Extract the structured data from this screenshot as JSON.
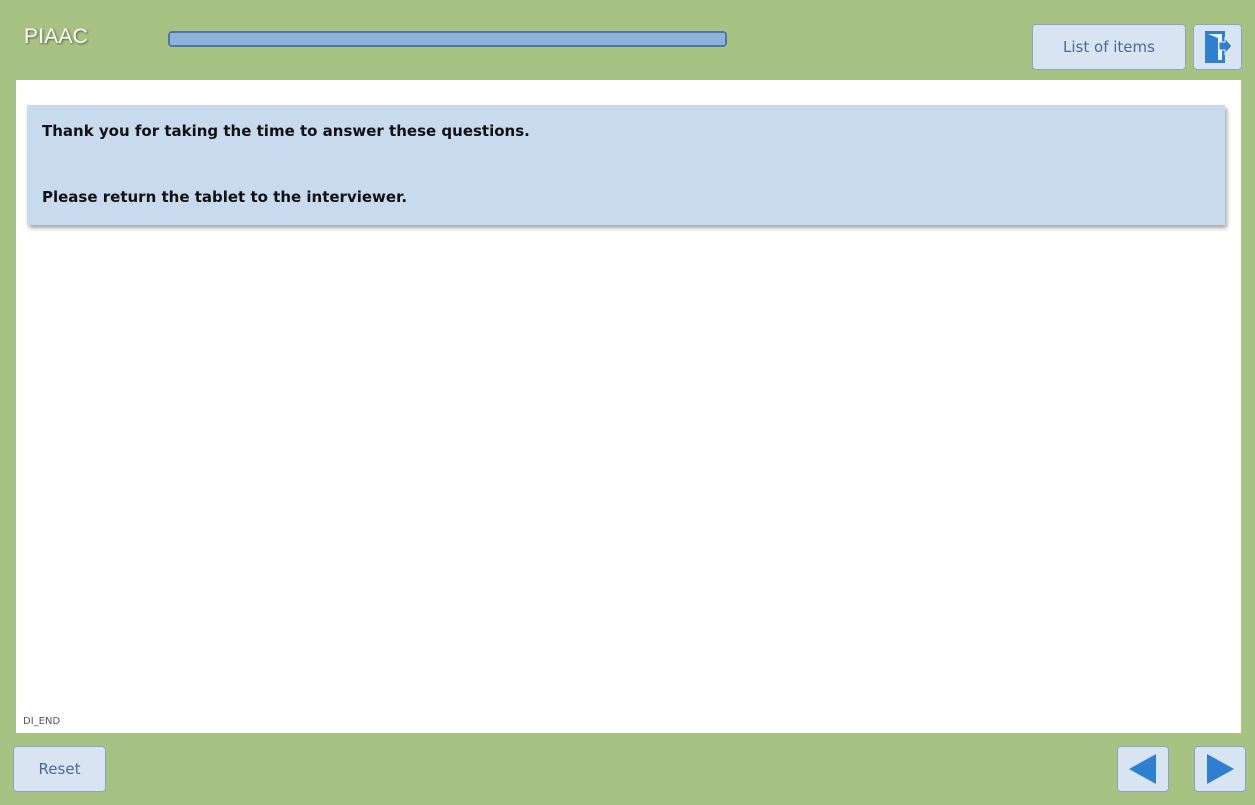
{
  "header": {
    "app_title": "PIAAC",
    "progress_fraction": 1.0,
    "list_items_label": "List of items",
    "exit_icon": "exit-door-icon"
  },
  "main": {
    "message_lines": [
      "Thank you for taking the time to answer these questions.",
      "Please return the tablet to the interviewer."
    ],
    "screen_id": "DI_END"
  },
  "footer": {
    "reset_label": "Reset",
    "previous_icon": "arrow-left-icon",
    "next_icon": "arrow-right-icon"
  },
  "colors": {
    "frame_background": "#a8c283",
    "content_background": "#ffffff",
    "message_background": "#c8daee",
    "button_background": "#d9e4f2",
    "button_text": "#4a6a96",
    "icon_blue": "#2f7fd1",
    "progress_border": "#4a78ad",
    "progress_fill": "#8fb2dd"
  }
}
